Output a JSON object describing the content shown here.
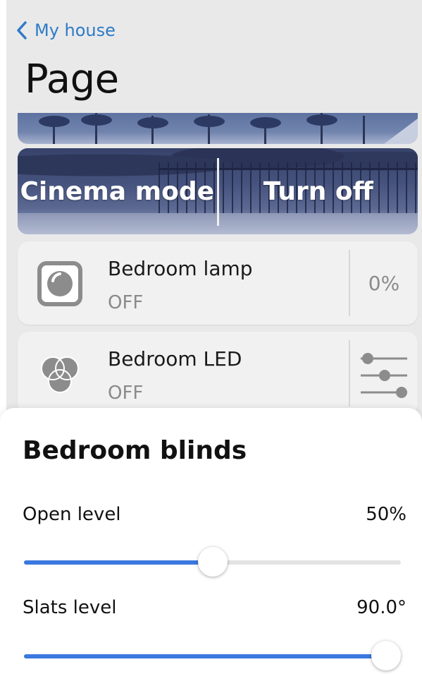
{
  "nav": {
    "back_label": "My house",
    "title": "Page"
  },
  "scene": {
    "buttons": [
      "Cinema mode",
      "Turn off"
    ]
  },
  "devices": [
    {
      "name": "Bedroom lamp",
      "state": "OFF",
      "value": "0%",
      "icon": "lamp-icon"
    },
    {
      "name": "Bedroom LED",
      "state": "OFF",
      "icon": "rgb-light-icon",
      "control": "sliders-icon"
    }
  ],
  "sheet": {
    "title": "Bedroom blinds",
    "controls": [
      {
        "label": "Open level",
        "value": "50%",
        "level": 0.5
      },
      {
        "label": "Slats level",
        "value": "90.0°",
        "level": 1.0
      }
    ]
  },
  "colors": {
    "accent": "#3a78e0",
    "link": "#2f7bc6",
    "background": "#e9e9ea"
  }
}
